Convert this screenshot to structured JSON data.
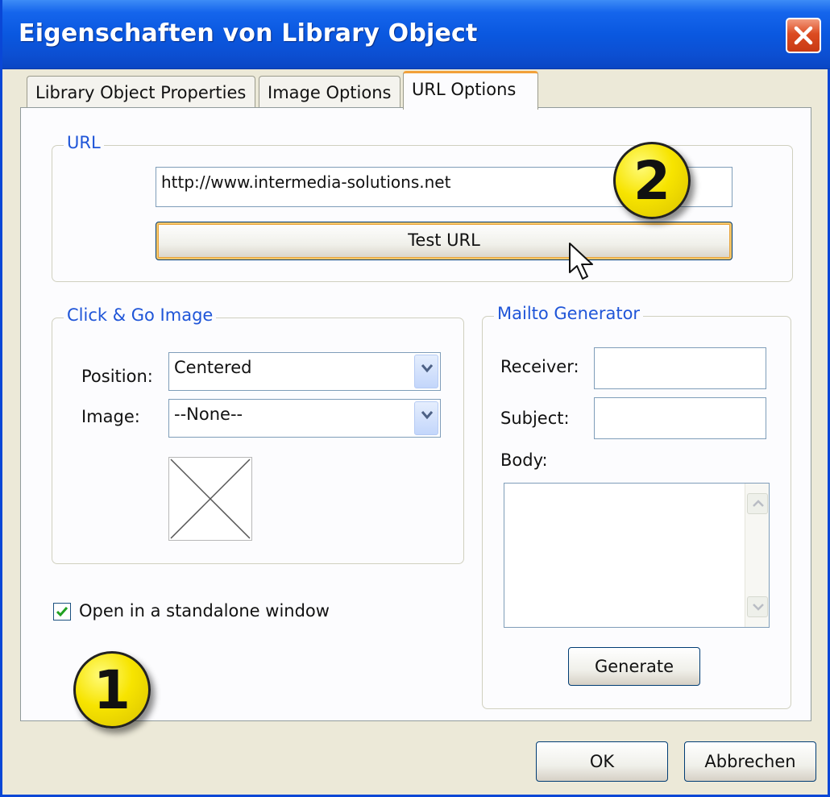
{
  "window": {
    "title": "Eigenschaften von Library Object"
  },
  "tabs": [
    {
      "label": "Library Object Properties",
      "active": false
    },
    {
      "label": "Image Options",
      "active": false
    },
    {
      "label": "URL Options",
      "active": true
    }
  ],
  "url_group": {
    "title": "URL",
    "url_value": "http://www.intermedia-solutions.net",
    "test_button": "Test URL"
  },
  "click_go_group": {
    "title": "Click & Go Image",
    "position_label": "Position:",
    "position_value": "Centered",
    "image_label": "Image:",
    "image_value": "--None--"
  },
  "checkbox": {
    "label": "Open in a standalone window",
    "checked": true
  },
  "mailto_group": {
    "title": "Mailto Generator",
    "receiver_label": "Receiver:",
    "receiver_value": "",
    "subject_label": "Subject:",
    "subject_value": "",
    "body_label": "Body:",
    "body_value": "",
    "generate_button": "Generate"
  },
  "footer": {
    "ok_button": "OK",
    "cancel_button": "Abbrechen"
  },
  "annotations": {
    "badge_1": "1",
    "badge_2": "2"
  },
  "colors": {
    "titlebar": "#0a58e0",
    "group_title": "#1f55d8",
    "badge": "#f7e400",
    "active_tab_accent": "#f2a13a"
  },
  "icons": [
    "close-icon",
    "chevron-down-icon",
    "checkmark-icon",
    "scroll-up-icon",
    "scroll-down-icon",
    "mouse-pointer-icon",
    "image-placeholder-icon"
  ]
}
